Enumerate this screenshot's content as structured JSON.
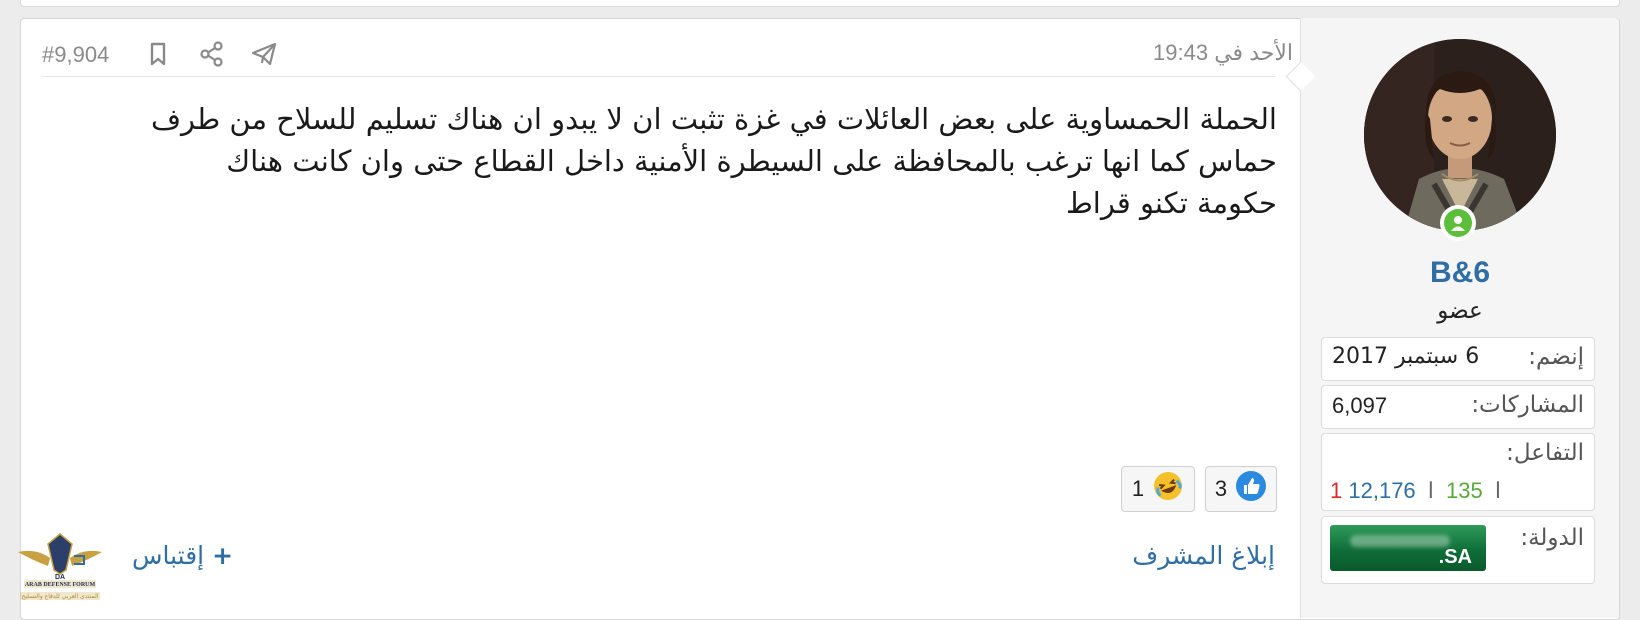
{
  "post": {
    "date": "الأحد في 19:43",
    "number": "#9,904",
    "body_lines": [
      "الحملة الحمساوية على بعض العائلات في غزة تثبت ان لا يبدو ان هناك تسليم للسلاح من طرف",
      "حماس كما انها ترغب بالمحافظة على السيطرة الأمنية داخل القطاع حتى وان كانت هناك",
      "حكومة تكنو قراط"
    ],
    "icons": [
      "telegram-icon",
      "share-icon",
      "bookmark-icon"
    ]
  },
  "reactions": [
    {
      "icon": "like-icon",
      "count": "3",
      "color": "#2a8ae0"
    },
    {
      "icon": "laugh-icon",
      "count": "1",
      "color": "#f5c02a"
    }
  ],
  "actions": {
    "report": "إبلاغ المشرف",
    "quote": "إقتباس",
    "quote_icon": "+"
  },
  "user": {
    "name": "B&6",
    "title": "عضو",
    "joined_label": "إنضم:",
    "joined_value": "6 سبتمبر 2017",
    "posts_label": "المشاركات:",
    "posts_value": "6,097",
    "reactions_label": "التفاعل:",
    "reaction_values": {
      "positive": "12,176",
      "neutral": "135",
      "negative": "1",
      "separator": "ا"
    },
    "country_label": "الدولة:",
    "country_flag_text": ".SA"
  },
  "logo": {
    "text_en": "ARAB DEFENSE FORUM",
    "text_ar": "المنتدى العربي للدفاع والتسليح",
    "letters": "DA"
  },
  "colors": {
    "link": "#2f6ea5",
    "positive": "#2f6ea5",
    "neutral": "#5aa83a",
    "negative": "#d92b2b",
    "online": "#5bbf3a"
  }
}
